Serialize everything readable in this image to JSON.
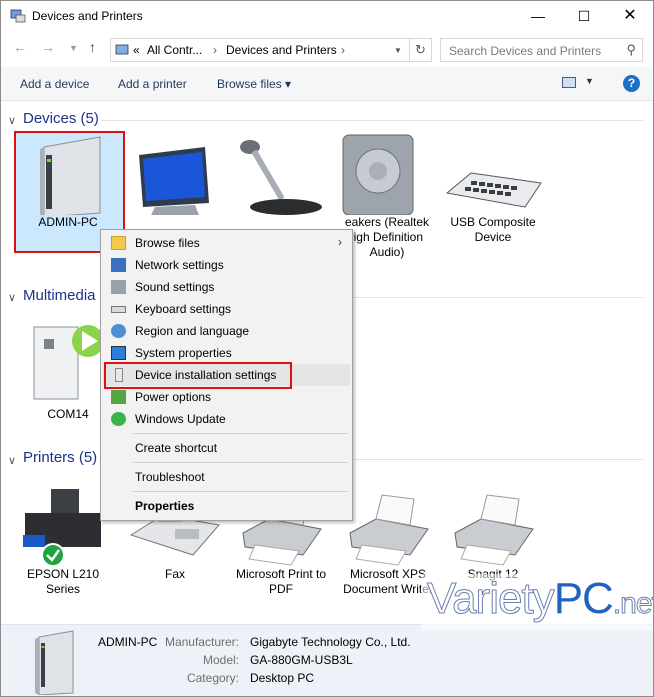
{
  "window": {
    "title": "Devices and Printers"
  },
  "address": {
    "prefix": "«",
    "crumb1": "All Contr...",
    "crumb2": "Devices and Printers",
    "search_placeholder": "Search Devices and Printers"
  },
  "toolbar": {
    "add_device": "Add a device",
    "add_printer": "Add a printer",
    "browse_files": "Browse files ▾"
  },
  "sections": {
    "devices": "Devices (5)",
    "multimedia": "Multimedia",
    "printers": "Printers (5)"
  },
  "devices": [
    {
      "label": "ADMIN-PC",
      "selected": true
    },
    {
      "label": ""
    },
    {
      "label": ""
    },
    {
      "label": "eakers (Realtek\nligh Definition\nAudio)"
    },
    {
      "label": "USB Composite\nDevice"
    }
  ],
  "multimedia": [
    {
      "label": "COM14"
    }
  ],
  "printers": [
    {
      "label": "EPSON L210\nSeries",
      "default": true
    },
    {
      "label": "Fax"
    },
    {
      "label": "Microsoft Print to\nPDF"
    },
    {
      "label": "Microsoft XPS\nDocument Writer"
    },
    {
      "label": "Snagit 12"
    }
  ],
  "context_menu": {
    "items": [
      {
        "label": "Browse files",
        "icon": "folder-icon",
        "submenu": true
      },
      {
        "label": "Network settings",
        "icon": "network-icon"
      },
      {
        "label": "Sound settings",
        "icon": "speaker-icon"
      },
      {
        "label": "Keyboard settings",
        "icon": "keyboard-icon"
      },
      {
        "label": "Region and language",
        "icon": "globe-icon"
      },
      {
        "label": "System properties",
        "icon": "monitor-icon"
      },
      {
        "label": "Device installation settings",
        "icon": "pc-icon",
        "highlighted": true
      },
      {
        "label": "Power options",
        "icon": "power-icon"
      },
      {
        "label": "Windows Update",
        "icon": "update-icon"
      },
      {
        "label": "Create shortcut"
      },
      {
        "label": "Troubleshoot"
      },
      {
        "label": "Properties",
        "bold": true
      }
    ]
  },
  "details": {
    "name": "ADMIN-PC",
    "manufacturer_label": "Manufacturer:",
    "manufacturer": "Gigabyte Technology Co., Ltd.",
    "model_label": "Model:",
    "model": "GA-880GM-USB3L",
    "category_label": "Category:",
    "category": "Desktop PC"
  },
  "watermark": {
    "part1": "Variety",
    "part2": "PC",
    "part3": ".net"
  },
  "colors": {
    "accent": "#1e3287",
    "highlight_red": "#e01010",
    "selection": "#cce8ff"
  }
}
